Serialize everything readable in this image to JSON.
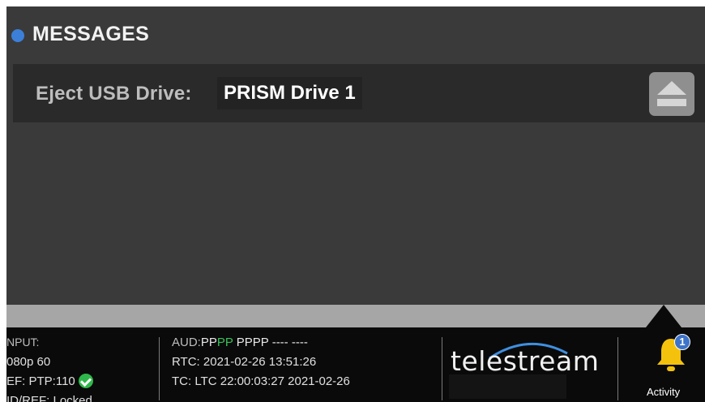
{
  "header": {
    "title": "MESSAGES"
  },
  "message": {
    "label": "Eject USB Drive:",
    "value": "PRISM Drive 1",
    "eject_icon": "eject-icon"
  },
  "status": {
    "input_label": "NPUT:",
    "input_format": "080p 60",
    "ref": "EF: PTP:110",
    "vidref": "ID/REF: Locked",
    "aud_prefix": "AUD:",
    "aud_pp1": "PP",
    "aud_pp2": "PP",
    "aud_rest": " PPPP ---- ----",
    "rtc": "RTC: 2021-02-26 13:51:26",
    "tc": "TC: LTC 22:00:03:27 2021-02-26"
  },
  "brand": {
    "logo": "telestream"
  },
  "activity": {
    "label": "Activity",
    "count": "1",
    "icon": "bell-icon"
  },
  "colors": {
    "accent": "#3c7fd8",
    "ok": "#2fb84a",
    "bell": "#f4c20d"
  }
}
